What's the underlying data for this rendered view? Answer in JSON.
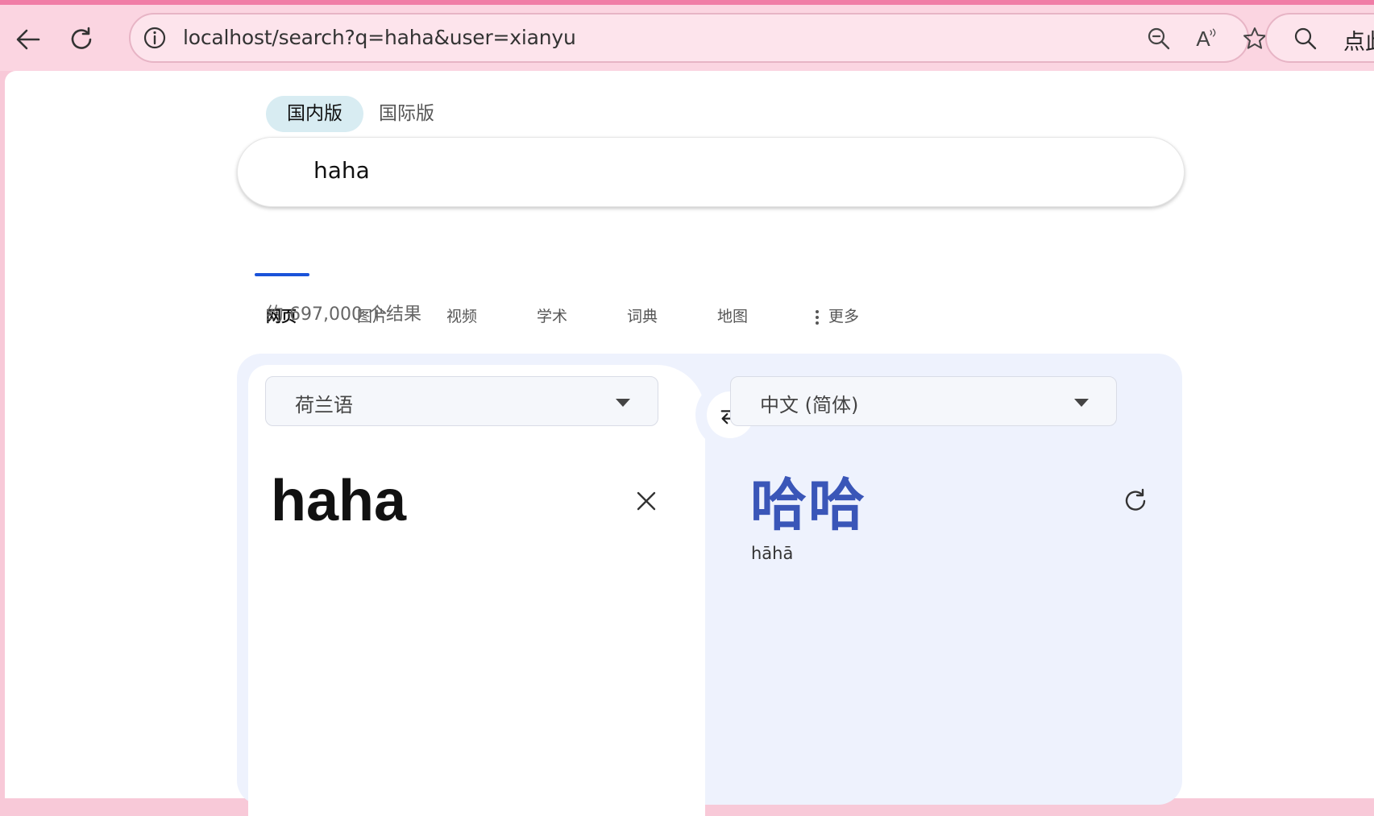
{
  "browser": {
    "url": "localhost/search?q=haha&user=xianyu",
    "read_aloud_label": "A",
    "side_search_text": "点此"
  },
  "editions": [
    {
      "label": "国内版",
      "active": true
    },
    {
      "label": "国际版",
      "active": false
    }
  ],
  "search": {
    "query": "haha"
  },
  "tabs": [
    {
      "label": "网页",
      "active": true
    },
    {
      "label": "图片"
    },
    {
      "label": "视频"
    },
    {
      "label": "学术"
    },
    {
      "label": "词典"
    },
    {
      "label": "地图"
    },
    {
      "label": "更多"
    }
  ],
  "results": {
    "count_text": "约 697,000 个结果"
  },
  "translator": {
    "source_language": "荷兰语",
    "target_language": "中文 (简体)",
    "source_text": "haha",
    "target_text": "哈哈",
    "pinyin": "hāhā"
  },
  "colors": {
    "accent": "#1a53d9",
    "translation_text": "#3a56b8",
    "browser_frame": "#f8c9d8"
  }
}
